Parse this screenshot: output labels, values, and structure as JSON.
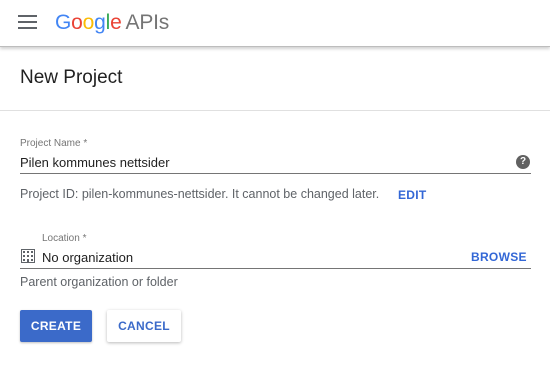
{
  "header": {
    "logo_letters": [
      {
        "char": "G",
        "color": "#4285F4"
      },
      {
        "char": "o",
        "color": "#EA4335"
      },
      {
        "char": "o",
        "color": "#FBBC05"
      },
      {
        "char": "g",
        "color": "#4285F4"
      },
      {
        "char": "l",
        "color": "#34A853"
      },
      {
        "char": "e",
        "color": "#EA4335"
      }
    ],
    "product_name": "APIs",
    "menu_icon": "hamburger-menu-icon"
  },
  "page": {
    "title": "New Project"
  },
  "form": {
    "project_name": {
      "label": "Project Name *",
      "value": "Pilen kommunes nettsider",
      "help_icon": "help-circle-icon",
      "help_glyph": "?"
    },
    "project_id": {
      "text": "Project ID: pilen-kommunes-nettsider. It cannot be changed later.",
      "edit_label": "EDIT"
    },
    "location": {
      "label": "Location *",
      "value": "No organization",
      "icon": "building-icon",
      "browse_label": "BROWSE",
      "helper": "Parent organization or folder"
    }
  },
  "actions": {
    "create_label": "CREATE",
    "cancel_label": "CANCEL"
  },
  "colors": {
    "accent": "#3b6ac9",
    "link": "#3367d6",
    "apis_gray": "#757575"
  }
}
